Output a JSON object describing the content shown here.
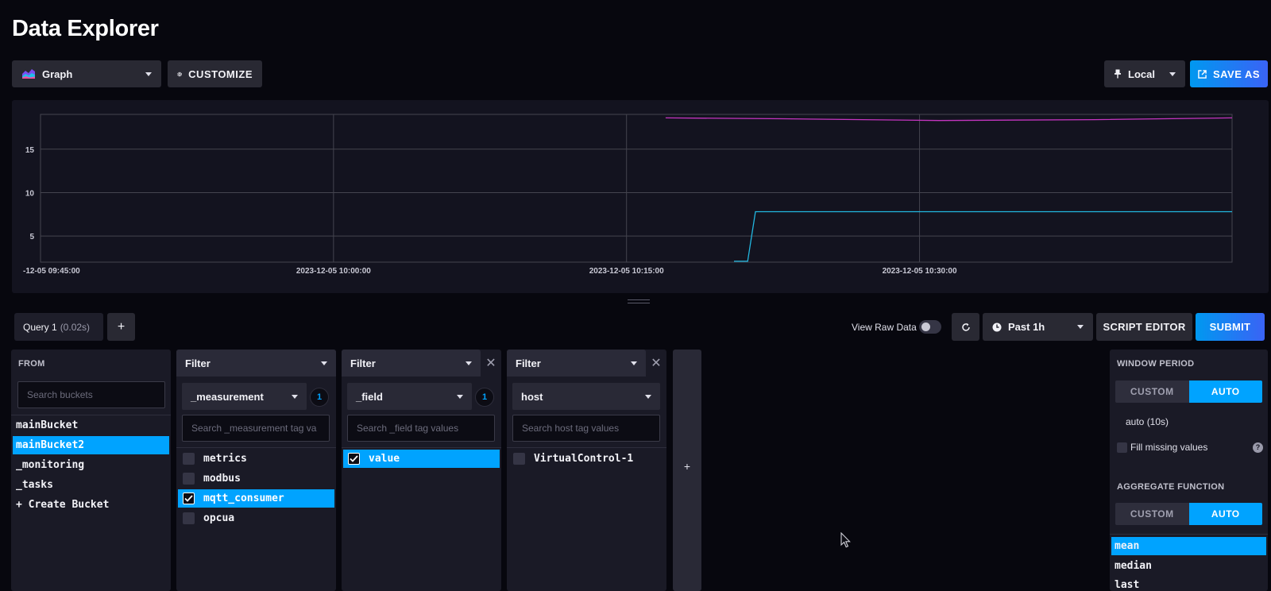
{
  "page": {
    "title": "Data Explorer"
  },
  "toolbar": {
    "view_type": "Graph",
    "customize_label": "CUSTOMIZE",
    "timezone": "Local",
    "save_as_label": "SAVE AS"
  },
  "chart_data": {
    "type": "line",
    "x_ticks": [
      "-12-05 09:45:00",
      "2023-12-05 10:00:00",
      "2023-12-05 10:15:00",
      "2023-12-05 10:30:00"
    ],
    "y_ticks": [
      "5",
      "10",
      "15"
    ],
    "ylim": [
      2,
      19
    ],
    "xlim_minutes": [
      0,
      61
    ],
    "grid": true,
    "series": [
      {
        "color": "#c535c0",
        "points": [
          [
            32,
            18.6
          ],
          [
            38,
            18.5
          ],
          [
            46,
            18.3
          ],
          [
            54,
            18.4
          ],
          [
            61,
            18.6
          ]
        ]
      },
      {
        "color": "#22b7e0",
        "points": [
          [
            35.5,
            2.1
          ],
          [
            36.2,
            2.1
          ],
          [
            36.6,
            7.8
          ],
          [
            45,
            7.8
          ],
          [
            61,
            7.8
          ]
        ]
      }
    ]
  },
  "query": {
    "tab_label": "Query 1",
    "tab_duration": "(0.02s)",
    "add_label": "+",
    "view_raw_label": "View Raw Data",
    "time_range": "Past 1h",
    "script_editor_label": "SCRIPT EDITOR",
    "submit_label": "SUBMIT"
  },
  "from": {
    "title": "FROM",
    "search_placeholder": "Search buckets",
    "buckets": [
      "mainBucket",
      "mainBucket2",
      "_monitoring",
      "_tasks",
      "+ Create Bucket"
    ]
  },
  "filters": [
    {
      "head": "Filter",
      "key": "_measurement",
      "count": "1",
      "search_placeholder": "Search _measurement tag va",
      "values": [
        "metrics",
        "modbus",
        "mqtt_consumer",
        "opcua"
      ]
    },
    {
      "head": "Filter",
      "key": "_field",
      "count": "1",
      "search_placeholder": "Search _field tag values",
      "values": [
        "value"
      ]
    },
    {
      "head": "Filter",
      "key": "host",
      "search_placeholder": "Search host tag values",
      "values": [
        "VirtualControl-1"
      ]
    }
  ],
  "add_filter_label": "+",
  "aggregate": {
    "window_title": "WINDOW PERIOD",
    "custom_label": "CUSTOM",
    "auto_label": "AUTO",
    "auto_value": "auto (10s)",
    "fill_label": "Fill missing values",
    "help_glyph": "?",
    "function_title": "AGGREGATE FUNCTION",
    "functions": [
      "mean",
      "median",
      "last"
    ]
  }
}
